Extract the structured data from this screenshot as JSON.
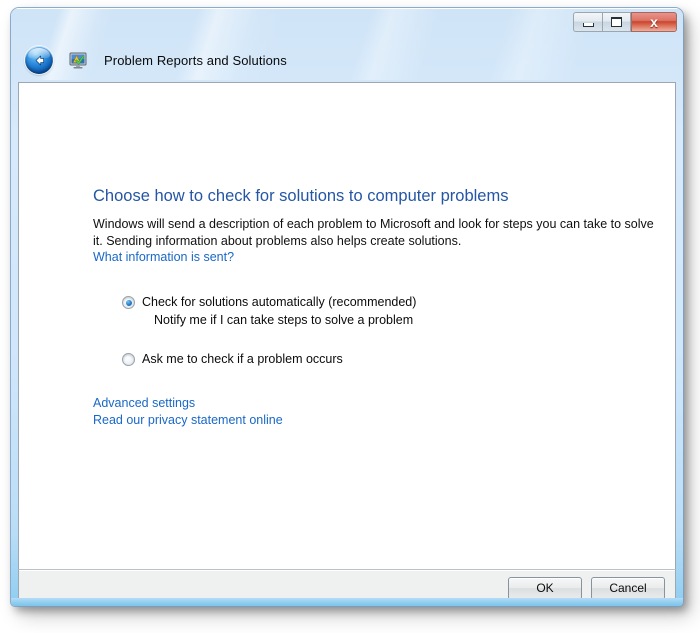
{
  "window": {
    "title": "Problem Reports and Solutions",
    "app_icon_name": "problem-reports-icon",
    "back_button_label": "Back",
    "controls": {
      "minimize_label": "Minimize",
      "maximize_label": "Maximize",
      "close_label": "Close",
      "close_glyph": "x"
    }
  },
  "content": {
    "heading": "Choose how to check for solutions to computer problems",
    "description_line1": "Windows will send a description of each problem to Microsoft and look for steps you can take to solve it.",
    "description_line2": "Sending information about problems also helps create solutions.",
    "what_information_link": "What information is sent?",
    "options": [
      {
        "label": "Check for solutions automatically (recommended)",
        "sublabel": "Notify me if I can take steps to solve a problem",
        "checked": true
      },
      {
        "label": "Ask me to check if a problem occurs",
        "sublabel": "",
        "checked": false
      }
    ],
    "links": [
      {
        "label": "Advanced settings"
      },
      {
        "label": "Read our privacy statement online"
      }
    ]
  },
  "footer": {
    "ok_label": "OK",
    "cancel_label": "Cancel"
  },
  "colors": {
    "heading_blue": "#2556a5",
    "link_blue": "#1a68c6",
    "glass_blue": "#cfe4f7",
    "close_red": "#c9442f",
    "footer_gray": "#eff0f0",
    "body_text": "#0b0b0b"
  }
}
